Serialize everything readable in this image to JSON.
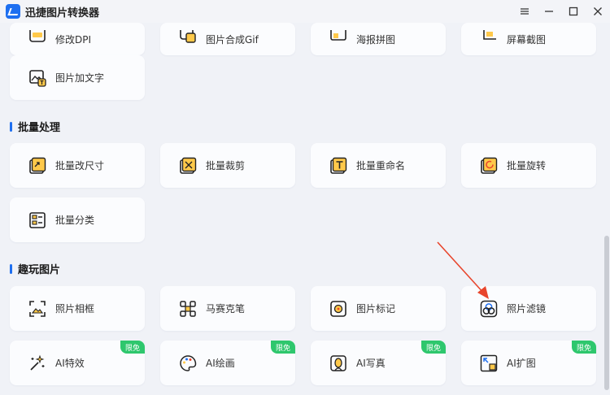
{
  "app": {
    "title": "迅捷图片转换器"
  },
  "window": {
    "minimize_icon": "minimize-icon",
    "maximize_icon": "maximize-icon",
    "close_icon": "close-icon",
    "menu_icon": "menu-icon"
  },
  "top_row": [
    {
      "label": "修改DPI",
      "icon": "dpi-icon"
    },
    {
      "label": "图片合成Gif",
      "icon": "gif-icon"
    },
    {
      "label": "海报拼图",
      "icon": "collage-icon"
    },
    {
      "label": "屏幕截图",
      "icon": "screenshot-icon"
    }
  ],
  "single_tool": {
    "label": "图片加文字",
    "icon": "image-text-icon"
  },
  "batch": {
    "title": "批量处理",
    "items": [
      {
        "label": "批量改尺寸",
        "icon": "resize-icon"
      },
      {
        "label": "批量裁剪",
        "icon": "crop-icon"
      },
      {
        "label": "批量重命名",
        "icon": "rename-icon"
      },
      {
        "label": "批量旋转",
        "icon": "rotate-icon"
      },
      {
        "label": "批量分类",
        "icon": "classify-icon"
      }
    ]
  },
  "fun": {
    "title": "趣玩图片",
    "items": [
      {
        "label": "照片相框",
        "icon": "frame-icon"
      },
      {
        "label": "马赛克笔",
        "icon": "mosaic-icon"
      },
      {
        "label": "图片标记",
        "icon": "marker-icon"
      },
      {
        "label": "照片滤镜",
        "icon": "filter-icon"
      },
      {
        "label": "AI特效",
        "icon": "sparkle-icon",
        "badge": "限免"
      },
      {
        "label": "AI绘画",
        "icon": "palette-icon",
        "badge": "限免"
      },
      {
        "label": "AI写真",
        "icon": "portrait-icon",
        "badge": "限免"
      },
      {
        "label": "AI扩图",
        "icon": "expand-icon",
        "badge": "限免"
      }
    ]
  },
  "colors": {
    "accent": "#1e6ff0",
    "badge": "#2ec76d",
    "annotation_arrow": "#e8452c",
    "icon_yellow": "#ffc94a"
  }
}
